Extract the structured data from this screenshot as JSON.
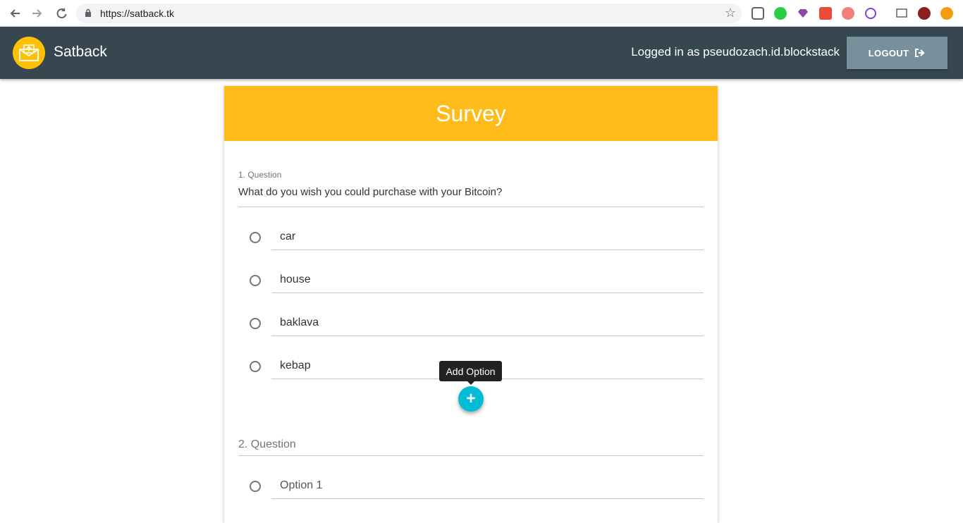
{
  "browser": {
    "url": "https://satback.tk",
    "back_icon": "arrow-left-icon",
    "forward_icon": "arrow-right-icon",
    "reload_icon": "reload-icon"
  },
  "header": {
    "app_name": "Satback",
    "logged_in_text": "Logged in as pseudozach.id.blockstack",
    "logout_label": "LOGOUT",
    "logo_icon": "envelope-logo-icon",
    "logout_icon": "sign-out-icon"
  },
  "survey": {
    "title": "Survey",
    "questions": [
      {
        "label": "1. Question",
        "text": "What do you wish you could purchase with your Bitcoin?",
        "options": [
          "car",
          "house",
          "baklava",
          "kebap"
        ]
      },
      {
        "label": "2. Question",
        "options": [
          "Option 1"
        ]
      }
    ],
    "add_option_tooltip": "Add Option",
    "add_icon": "plus-icon"
  },
  "colors": {
    "header_bg": "#37474f",
    "survey_header": "#ffbb1a",
    "fab": "#00bcd4",
    "logout_bg": "#78909c"
  }
}
